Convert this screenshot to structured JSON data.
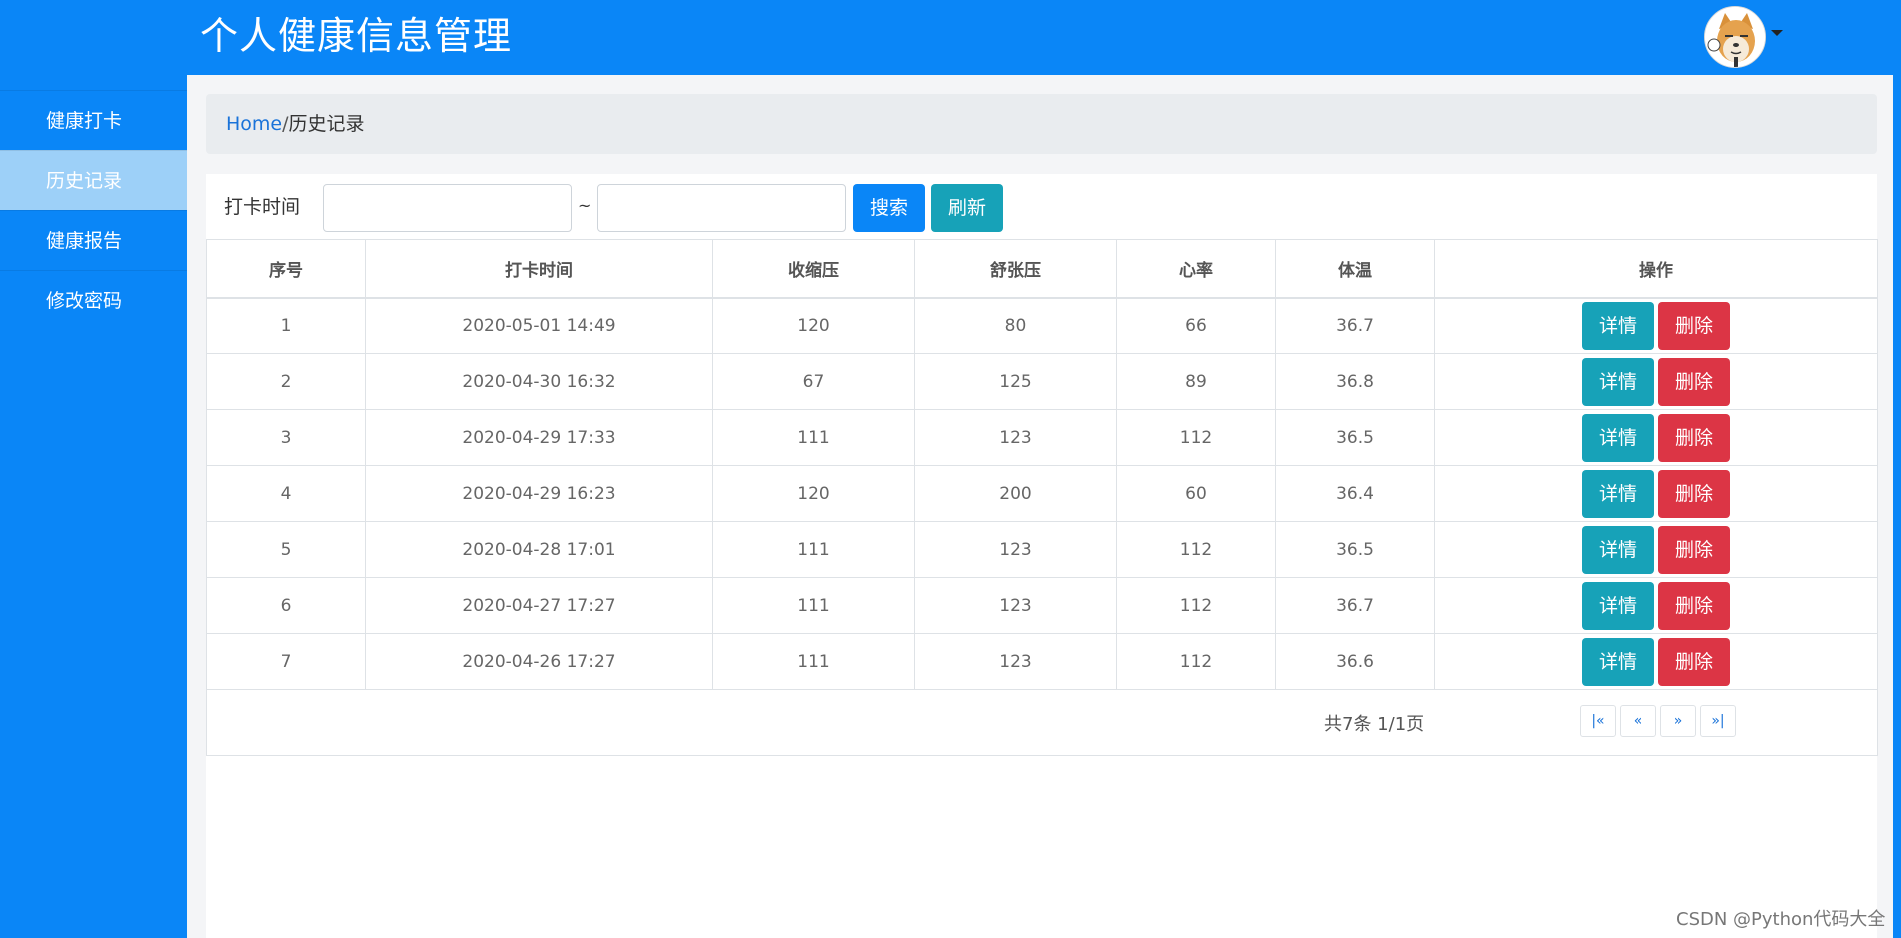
{
  "header": {
    "title": "个人健康信息管理",
    "avatar_icon": "shiba-dog-avatar"
  },
  "sidebar": {
    "items": [
      {
        "label": "健康打卡"
      },
      {
        "label": "历史记录",
        "active": true
      },
      {
        "label": "健康报告"
      },
      {
        "label": "修改密码"
      }
    ]
  },
  "breadcrumb": {
    "home": "Home",
    "separator": "/",
    "current": "历史记录"
  },
  "filter": {
    "label": "打卡时间",
    "start_value": "",
    "end_value": "",
    "separator": "~",
    "search_label": "搜索",
    "refresh_label": "刷新"
  },
  "table": {
    "columns": [
      "序号",
      "打卡时间",
      "收缩压",
      "舒张压",
      "心率",
      "体温",
      "操作"
    ],
    "rows": [
      {
        "no": "1",
        "time": "2020-05-01 14:49",
        "sys": "120",
        "dia": "80",
        "hr": "66",
        "temp": "36.7"
      },
      {
        "no": "2",
        "time": "2020-04-30 16:32",
        "sys": "67",
        "dia": "125",
        "hr": "89",
        "temp": "36.8"
      },
      {
        "no": "3",
        "time": "2020-04-29 17:33",
        "sys": "111",
        "dia": "123",
        "hr": "112",
        "temp": "36.5"
      },
      {
        "no": "4",
        "time": "2020-04-29 16:23",
        "sys": "120",
        "dia": "200",
        "hr": "60",
        "temp": "36.4"
      },
      {
        "no": "5",
        "time": "2020-04-28 17:01",
        "sys": "111",
        "dia": "123",
        "hr": "112",
        "temp": "36.5"
      },
      {
        "no": "6",
        "time": "2020-04-27 17:27",
        "sys": "111",
        "dia": "123",
        "hr": "112",
        "temp": "36.7"
      },
      {
        "no": "7",
        "time": "2020-04-26 17:27",
        "sys": "111",
        "dia": "123",
        "hr": "112",
        "temp": "36.6"
      }
    ],
    "actions": {
      "detail": "详情",
      "delete": "删除"
    }
  },
  "pagination": {
    "summary": "共7条 1/1页",
    "first": "|«",
    "prev": "«",
    "next": "»",
    "last": "»|"
  },
  "watermark": "CSDN @Python代码大全",
  "colors": {
    "primary": "#0a86f7",
    "info": "#17a2b8",
    "danger": "#dc3545",
    "sidebar_active": "#9dd0f8"
  }
}
